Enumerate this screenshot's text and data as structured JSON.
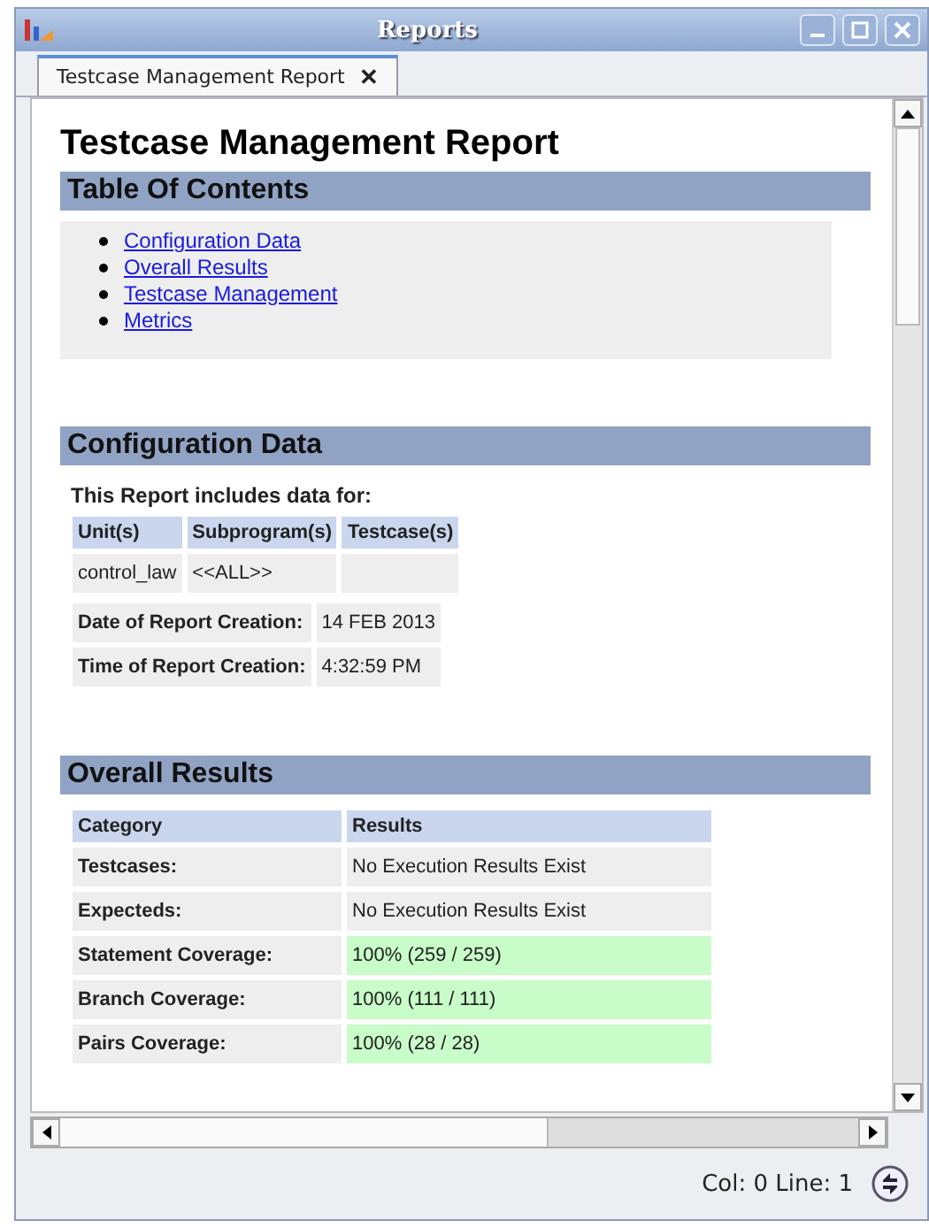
{
  "window": {
    "title": "Reports"
  },
  "tabs": [
    {
      "label": "Testcase Management Report",
      "selected": true,
      "close": "✕"
    }
  ],
  "report": {
    "title": "Testcase Management Report",
    "toc": {
      "heading": "Table Of Contents",
      "links": [
        "Configuration Data",
        "Overall Results",
        "Testcase Management",
        "Metrics"
      ]
    },
    "configuration": {
      "heading": "Configuration Data",
      "intro": "This Report includes data for:",
      "columns": [
        "Unit(s)",
        "Subprogram(s)",
        "Testcase(s)"
      ],
      "rows": [
        [
          "control_law",
          "<<ALL>>",
          ""
        ]
      ],
      "details": [
        {
          "label": "Date of Report Creation:",
          "value": "14 FEB 2013"
        },
        {
          "label": "Time of Report Creation:",
          "value": "4:32:59 PM"
        }
      ]
    },
    "overall": {
      "heading": "Overall Results",
      "columns": [
        "Category",
        "Results"
      ],
      "rows": [
        {
          "category": "Testcases:",
          "result": "No Execution Results Exist",
          "passed": false
        },
        {
          "category": "Expecteds:",
          "result": "No Execution Results Exist",
          "passed": false
        },
        {
          "category": "Statement Coverage:",
          "result": "100% (259 / 259)",
          "passed": true
        },
        {
          "category": "Branch Coverage:",
          "result": "100% (111 / 111)",
          "passed": true
        },
        {
          "category": "Pairs Coverage:",
          "result": "100% (28 / 28)",
          "passed": true
        }
      ]
    }
  },
  "status_bar": {
    "position": "Col: 0 Line: 1"
  }
}
